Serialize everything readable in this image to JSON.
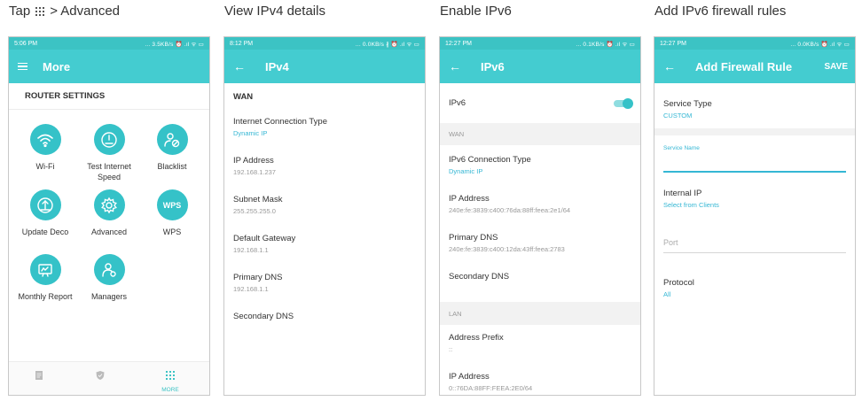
{
  "captions": {
    "c1_tap": "Tap",
    "c1_rest": "> Advanced",
    "c2": "View IPv4 details",
    "c3": "Enable IPv6",
    "c4": "Add IPv6 firewall rules"
  },
  "phone1": {
    "status_time": "5:06 PM",
    "status_right": "... 3.5KB/s ⏰ .ıl ᯤ ▭",
    "title": "More",
    "section": "ROUTER SETTINGS",
    "tiles": [
      {
        "label": "Wi-Fi",
        "icon": "wifi-icon"
      },
      {
        "label": "Test Internet Speed",
        "icon": "speedometer-icon"
      },
      {
        "label": "Blacklist",
        "icon": "blocked-user-icon"
      },
      {
        "label": "Update Deco",
        "icon": "update-icon"
      },
      {
        "label": "Advanced",
        "icon": "gear-icon"
      },
      {
        "label": "WPS",
        "icon": "wps-icon"
      },
      {
        "label": "Monthly Report",
        "icon": "report-icon"
      },
      {
        "label": "Managers",
        "icon": "managers-icon"
      }
    ],
    "wps_text": "WPS",
    "nav_more": "MORE"
  },
  "phone2": {
    "status_time": "8:12 PM",
    "status_right": "... 0.0KB/s ∦ ⏰ .ıl ᯤ ▭",
    "title": "IPv4",
    "section": "WAN",
    "rows": [
      {
        "label": "Internet Connection Type",
        "value": "Dynamic IP"
      },
      {
        "label": "IP Address",
        "value": "192.168.1.237"
      },
      {
        "label": "Subnet Mask",
        "value": "255.255.255.0"
      },
      {
        "label": "Default Gateway",
        "value": "192.168.1.1"
      },
      {
        "label": "Primary DNS",
        "value": "192.168.1.1"
      },
      {
        "label": "Secondary DNS",
        "value": ""
      }
    ]
  },
  "phone3": {
    "status_time": "12:27 PM",
    "status_right": "... 0.1KB/s ⏰ .ıl ᯤ ▭",
    "title": "IPv6",
    "ipv6_label": "IPv6",
    "ipv6_enabled": true,
    "wan_band": "WAN",
    "rows": [
      {
        "label": "IPv6 Connection Type",
        "value": "Dynamic IP"
      },
      {
        "label": "IP Address",
        "value": "240e:fe:3839:c400:76da:88ff:feea:2e1/64"
      },
      {
        "label": "Primary DNS",
        "value": "240e:fe:3839:c400:12da:43ff:feea:2783"
      },
      {
        "label": "Secondary DNS",
        "value": ""
      }
    ],
    "lan_band": "LAN",
    "lan_rows": [
      {
        "label": "Address Prefix",
        "value": "::"
      },
      {
        "label": "IP Address",
        "value": "0::76DA:88FF:FEEA:2E0/64"
      }
    ]
  },
  "phone4": {
    "status_time": "12:27 PM",
    "status_right": "... 0.0KB/s ⏰ .ıl ᯤ ▭",
    "title": "Add Firewall Rule",
    "save": "SAVE",
    "service_type_label": "Service Type",
    "service_type_value": "CUSTOM",
    "service_name_label": "Service Name",
    "internal_ip_label": "Internal IP",
    "internal_ip_value": "Select from Clients",
    "port_placeholder": "Port",
    "protocol_label": "Protocol",
    "protocol_value": "All"
  },
  "colors": {
    "accent": "#44ccd0",
    "status_bar": "#3cc3c4",
    "link": "#35b7d4"
  }
}
